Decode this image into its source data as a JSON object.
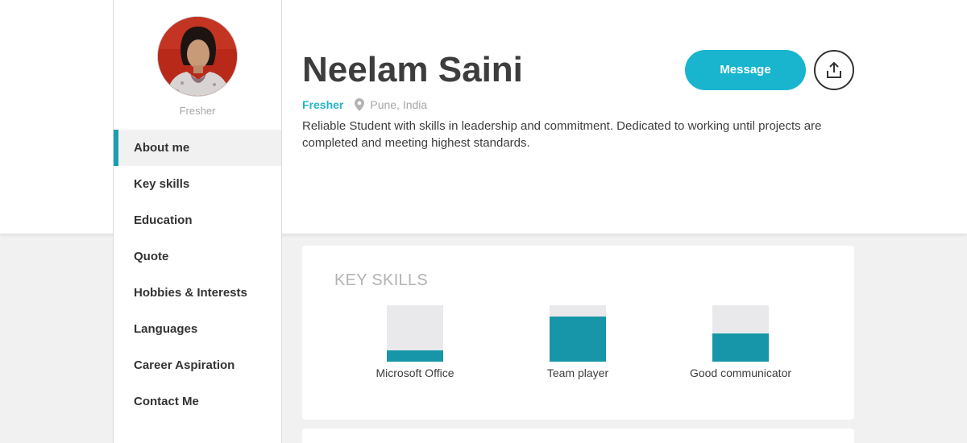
{
  "profile": {
    "name": "Neelam Saini",
    "status": "Fresher",
    "location": "Pune, India",
    "summary": "Reliable Student with skills in leadership and commitment. Dedicated to working until projects are completed and meeting highest standards.",
    "message_label": "Message",
    "share_icon": "share-icon"
  },
  "sidebar": {
    "role": "Fresher",
    "items": [
      {
        "label": "About me",
        "active": true
      },
      {
        "label": "Key skills",
        "active": false
      },
      {
        "label": "Education",
        "active": false
      },
      {
        "label": "Quote",
        "active": false
      },
      {
        "label": "Hobbies & Interests",
        "active": false
      },
      {
        "label": "Languages",
        "active": false
      },
      {
        "label": "Career Aspiration",
        "active": false
      },
      {
        "label": "Contact Me",
        "active": false
      }
    ]
  },
  "key_skills": {
    "title": "KEY SKILLS",
    "skills": [
      {
        "label": "Microsoft Office",
        "level": 0.2
      },
      {
        "label": "Team player",
        "level": 0.8
      },
      {
        "label": "Good communicator",
        "level": 0.5
      }
    ]
  },
  "colors": {
    "accent": "#19b5cf",
    "bar_fill": "#1696a8",
    "bar_track": "#e9e9ec",
    "status": "#25b4c7"
  }
}
